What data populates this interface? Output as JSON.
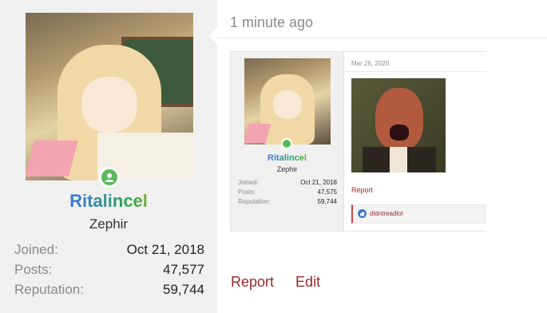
{
  "user_card": {
    "username": "Ritalincel",
    "title": "Zephir",
    "stats": [
      {
        "label": "Joined:",
        "value": "Oct 21, 2018"
      },
      {
        "label": "Posts:",
        "value": "47,577"
      },
      {
        "label": "Reputation:",
        "value": "59,744"
      }
    ],
    "online_color": "#5cb85c"
  },
  "post": {
    "timestamp": "1 minute ago",
    "actions": {
      "report": "Report",
      "edit": "Edit"
    },
    "link_color": "#9a2a2a"
  },
  "embedded_post": {
    "username": "Ritalincel",
    "title": "Zephir",
    "stats": [
      {
        "label": "Joined:",
        "value": "Oct 21, 2018"
      },
      {
        "label": "Posts:",
        "value": "47,575"
      },
      {
        "label": "Reputation:",
        "value": "59,744"
      }
    ],
    "date": "Mar 26, 2020",
    "report_label": "Report",
    "liked_by": "didntreadlol",
    "like_icon": "thumbs-up-icon"
  }
}
